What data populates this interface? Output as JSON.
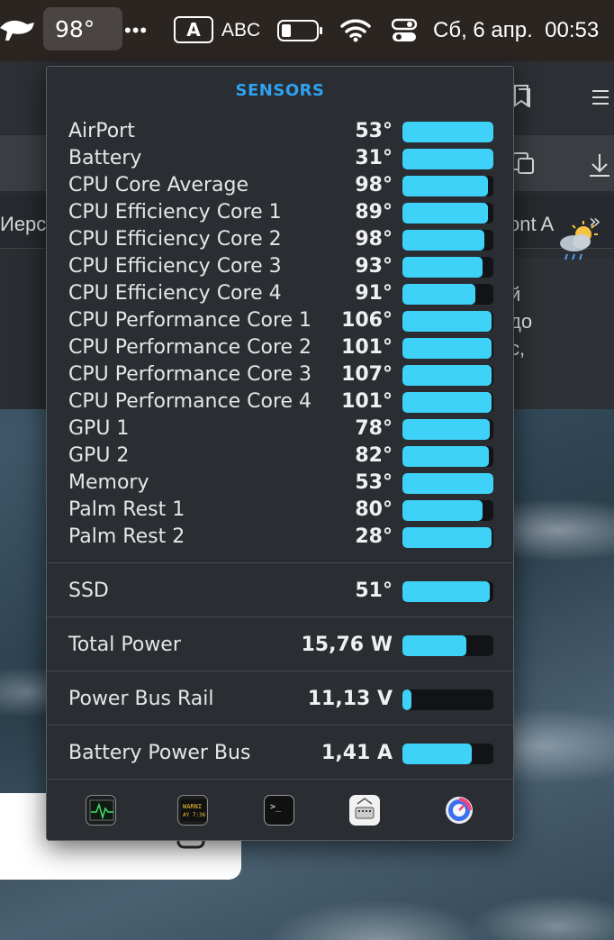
{
  "menubar": {
    "temperature": "98°",
    "more": "•••",
    "input_badge": "A",
    "input_label": "ABC",
    "datetime": "Сб, 6 апр.  00:53"
  },
  "browser": {
    "bookmark_left": "Иерс",
    "bookmark_right": "ont A",
    "weather_lines": [
      "й",
      "до",
      "с,"
    ]
  },
  "sensors": {
    "title": "SENSORS",
    "group_main": [
      {
        "name": "AirPort",
        "value": "53°",
        "level": 1.0
      },
      {
        "name": "Battery",
        "value": "31°",
        "level": 1.0
      },
      {
        "name": "CPU Core Average",
        "value": "98°",
        "level": 0.94
      },
      {
        "name": "CPU Efficiency Core 1",
        "value": "89°",
        "level": 0.94
      },
      {
        "name": "CPU Efficiency Core 2",
        "value": "98°",
        "level": 0.9
      },
      {
        "name": "CPU Efficiency Core 3",
        "value": "93°",
        "level": 0.88
      },
      {
        "name": "CPU Efficiency Core 4",
        "value": "91°",
        "level": 0.8
      },
      {
        "name": "CPU Performance Core 1",
        "value": "106°",
        "level": 0.98
      },
      {
        "name": "CPU Performance Core 2",
        "value": "101°",
        "level": 0.98
      },
      {
        "name": "CPU Performance Core 3",
        "value": "107°",
        "level": 0.98
      },
      {
        "name": "CPU Performance Core 4",
        "value": "101°",
        "level": 0.98
      },
      {
        "name": "GPU 1",
        "value": "78°",
        "level": 0.96
      },
      {
        "name": "GPU 2",
        "value": "82°",
        "level": 0.95
      },
      {
        "name": "Memory",
        "value": "53°",
        "level": 1.0
      },
      {
        "name": "Palm Rest 1",
        "value": "80°",
        "level": 0.88
      },
      {
        "name": "Palm Rest 2",
        "value": "28°",
        "level": 0.98
      }
    ],
    "ssd": {
      "name": "SSD",
      "value": "51°",
      "level": 0.96
    },
    "total_power": {
      "name": "Total Power",
      "value": "15,76 W",
      "level": 0.7
    },
    "power_bus_rail": {
      "name": "Power Bus Rail",
      "value": "11,13 V",
      "level": 0.1
    },
    "battery_power_bus": {
      "name": "Battery Power Bus",
      "value": "1,41 A",
      "level": 0.76
    }
  },
  "dock_apps": [
    {
      "name": "activity-monitor-app-icon"
    },
    {
      "name": "console-app-icon"
    },
    {
      "name": "terminal-app-icon"
    },
    {
      "name": "system-information-app-icon"
    },
    {
      "name": "istat-menus-app-icon"
    }
  ],
  "colors": {
    "accent": "#2ea2f0",
    "bar_fill": "#3fd2f8",
    "bar_track": "#111316",
    "popover_bg": "#2a2d32"
  }
}
